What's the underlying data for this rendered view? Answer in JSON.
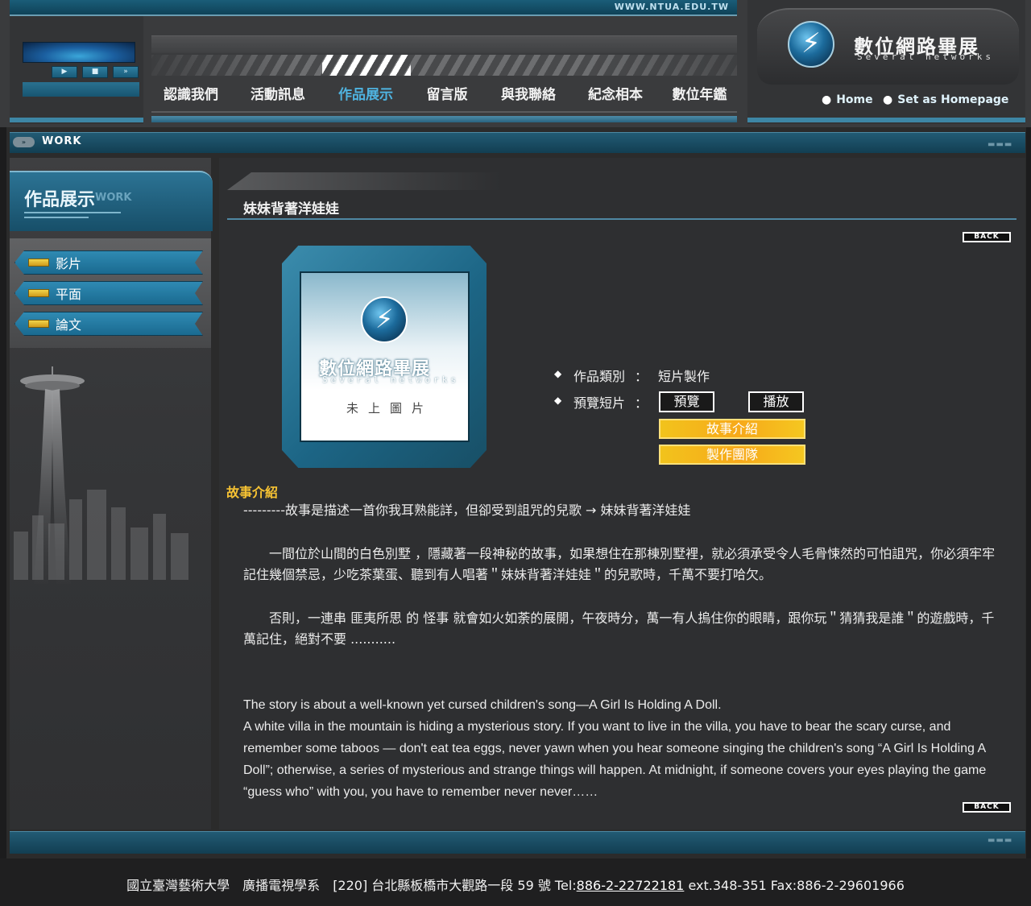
{
  "header": {
    "url": "WWW.NTUA.EDU.TW",
    "player": {
      "play_label": "▶",
      "stop_label": "■",
      "next_label": "»"
    },
    "nav": [
      "認識我們",
      "活動訊息",
      "作品展示",
      "留言版",
      "與我聯絡",
      "紀念相本",
      "數位年鑑"
    ],
    "active_nav": "作品展示",
    "logo": {
      "title": "數位網路畢展",
      "subtitle": "Several networks"
    },
    "links": {
      "home": "Home",
      "homepage": "Set as Homepage"
    }
  },
  "section": {
    "label": "WORK",
    "pill": "»"
  },
  "sidebar": {
    "title": "作品展示",
    "title_en": "WORK",
    "items": [
      {
        "label": "影片"
      },
      {
        "label": "平面"
      },
      {
        "label": "論文"
      }
    ]
  },
  "work": {
    "title": "妹妹背著洋娃娃",
    "back_label": "BACK",
    "placeholder": {
      "title": "數位網路畢展",
      "subtitle": "Several networks",
      "no_image": "未上圖片"
    },
    "category_label": "作品類別",
    "category_value": "短片製作",
    "preview_label": "預覽短片",
    "colon": "：",
    "buttons": {
      "preview": "預覽",
      "play": "播放",
      "story": "故事介紹",
      "team": "製作團隊"
    }
  },
  "story": {
    "heading": "故事介紹",
    "lead": "---------故事是描述一首你我耳熟能詳，但卻受到詛咒的兒歌 → 妹妹背著洋娃娃",
    "para1": "　　一間位於山間的白色別墅 ，隱藏著一段神秘的故事，如果想住在那棟別墅裡，就必須承受令人毛骨悚然的可怕詛咒，你必須牢牢記住幾個禁忌，少吃茶葉蛋、聽到有人唱著＂妹妹背著洋娃娃＂的兒歌時，千萬不要打哈欠。",
    "para2": "　　否則，一連串 匪夷所思 的 怪事 就會如火如荼的展開，午夜時分，萬一有人摀住你的眼睛，跟你玩＂猜猜我是誰＂的遊戲時，千萬記住，絕對不要 ...........",
    "en1": "The story is about a well-known yet cursed children's song—A Girl Is Holding A Doll.",
    "en2": "A white villa in the mountain is hiding a mysterious story. If you want to live in the villa, you have to bear the scary curse, and remember some taboos — don't eat tea eggs, never yawn when you hear someone singing the children's song “A Girl Is Holding A Doll”; otherwise, a series of mysterious and strange things will happen. At midnight, if someone covers your eyes playing the game “guess who” with you, you have to remember never never……"
  },
  "footer": {
    "school": "國立臺灣藝術大學",
    "dept": "廣播電視學系",
    "address": "[220] 台北縣板橋市大觀路一段 59 號 Tel:",
    "tel": "886-2-22722181",
    "rest": " ext.348-351 Fax:886-2-29601966"
  },
  "colors": {
    "accent": "#4fb3e0",
    "heading_gold": "#f6c233",
    "bar_blue": "#1a5d78"
  }
}
